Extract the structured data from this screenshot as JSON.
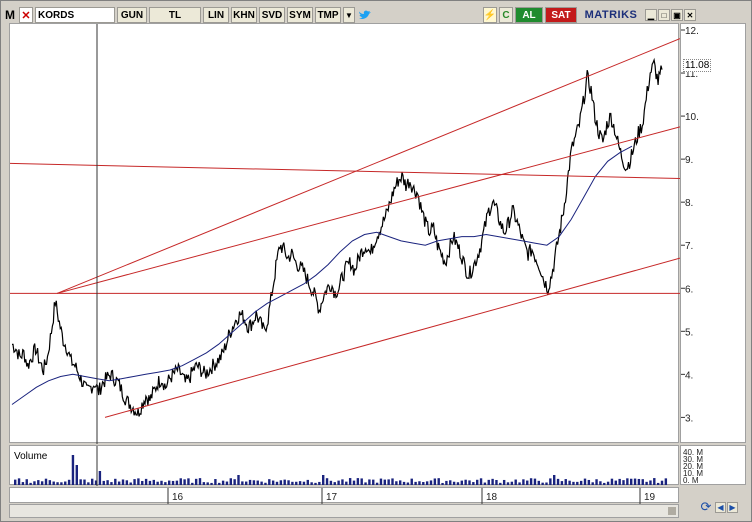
{
  "toolbar": {
    "logo": "M",
    "close": "✕",
    "symbol": "KORDS",
    "period": "GUN",
    "currency": "TL",
    "scale": "LIN",
    "khn": "KHN",
    "svd": "SVD",
    "sym": "SYM",
    "tmp": "TMP",
    "dropdown": "▼",
    "bolt": "⚡",
    "refresh": "C",
    "buy": "AL",
    "sell": "SAT",
    "brand": "MATRIKS",
    "win_min": "▁",
    "win_restore": "□",
    "win_max": "▣",
    "win_close": "✕"
  },
  "volume": {
    "label": "Volume",
    "ticks": [
      "40. M",
      "30. M",
      "20. M",
      "10. M",
      "0. M"
    ]
  },
  "nav": {
    "refresh": "⟳",
    "left": "◀",
    "right": "▶"
  },
  "price_axis": {
    "ticks": [
      "3.",
      "4.",
      "5.",
      "6.",
      "7.",
      "8.",
      "9.",
      "10.",
      "11.",
      "12."
    ],
    "last_price": "11.08"
  },
  "chart_data": {
    "type": "line",
    "x_ticks": [
      "16",
      "17",
      "18",
      "19"
    ],
    "ylim": [
      2.8,
      12.0
    ],
    "y_ticks": [
      3,
      4,
      5,
      6,
      7,
      8,
      9,
      10,
      11,
      12
    ],
    "series": [
      {
        "values": [
          4.7,
          4.6,
          4.4,
          4.5,
          4.2,
          4.4,
          4.6,
          4.3,
          4.1,
          4.4,
          5.0,
          5.7,
          5.2,
          4.8,
          4.6,
          4.3,
          4.2,
          4.0,
          3.8,
          3.6,
          3.7,
          3.8,
          3.6,
          3.8,
          3.9,
          4.0,
          3.9,
          3.8,
          3.6,
          3.4,
          3.3,
          3.2,
          3.1,
          3.3,
          3.5,
          3.4,
          3.6,
          3.8,
          3.9,
          3.7,
          3.9,
          4.0,
          4.1,
          4.0,
          3.8,
          3.9,
          4.1,
          4.2,
          4.1,
          4.0,
          4.1,
          4.2,
          4.3,
          4.4,
          4.6,
          4.9,
          5.1,
          5.3,
          5.4,
          5.3,
          5.1,
          5.2,
          5.4,
          5.2,
          5.0,
          5.3,
          5.9,
          6.5,
          7.0,
          6.9,
          6.7,
          6.8,
          6.6,
          6.5,
          6.4,
          6.2,
          6.0,
          5.8,
          5.5,
          5.8,
          6.0,
          6.1,
          5.9,
          6.0,
          6.3,
          6.5,
          6.6,
          6.4,
          6.7,
          6.9,
          7.0,
          6.8,
          7.1,
          7.3,
          7.5,
          7.7,
          8.0,
          8.3,
          8.5,
          8.6,
          8.4,
          8.5,
          8.3,
          8.2,
          7.8,
          7.5,
          7.3,
          7.4,
          7.0,
          6.8,
          6.6,
          6.9,
          7.2,
          7.0,
          6.8,
          6.5,
          6.3,
          6.5,
          6.7,
          7.0,
          7.4,
          7.8,
          8.0,
          7.8,
          7.5,
          7.3,
          7.5,
          7.8,
          7.6,
          7.3,
          7.0,
          6.8,
          6.9,
          6.7,
          6.5,
          6.2,
          6.0,
          6.3,
          6.8,
          7.3,
          7.8,
          8.5,
          9.2,
          9.5,
          9.8,
          10.3,
          10.9,
          10.6,
          10.0,
          9.6,
          9.4,
          9.8,
          10.0,
          9.7,
          9.3,
          9.0,
          8.8,
          9.0,
          9.3,
          9.6,
          9.8,
          10.4,
          11.0,
          11.2,
          10.8,
          11.08
        ]
      },
      {
        "values": [
          3.3,
          3.5,
          3.7,
          3.85,
          3.95,
          4.0,
          3.95,
          3.9,
          3.85,
          3.9,
          3.95,
          4.0,
          4.05,
          4.1,
          4.2,
          4.35,
          4.5,
          4.7,
          4.95,
          5.2,
          5.45,
          5.65,
          5.8,
          5.95,
          6.1,
          6.3,
          6.55,
          6.85,
          7.1,
          7.25,
          7.3,
          7.2,
          7.1,
          7.05,
          7.0,
          7.1,
          7.15,
          7.2,
          7.2,
          7.25,
          7.2,
          7.15,
          7.1,
          7.05,
          7.0,
          7.2,
          7.6,
          8.1,
          8.6,
          8.95,
          9.15,
          9.3
        ]
      }
    ],
    "annotations": "trend channel lines, horizontal support/resistance lines"
  }
}
